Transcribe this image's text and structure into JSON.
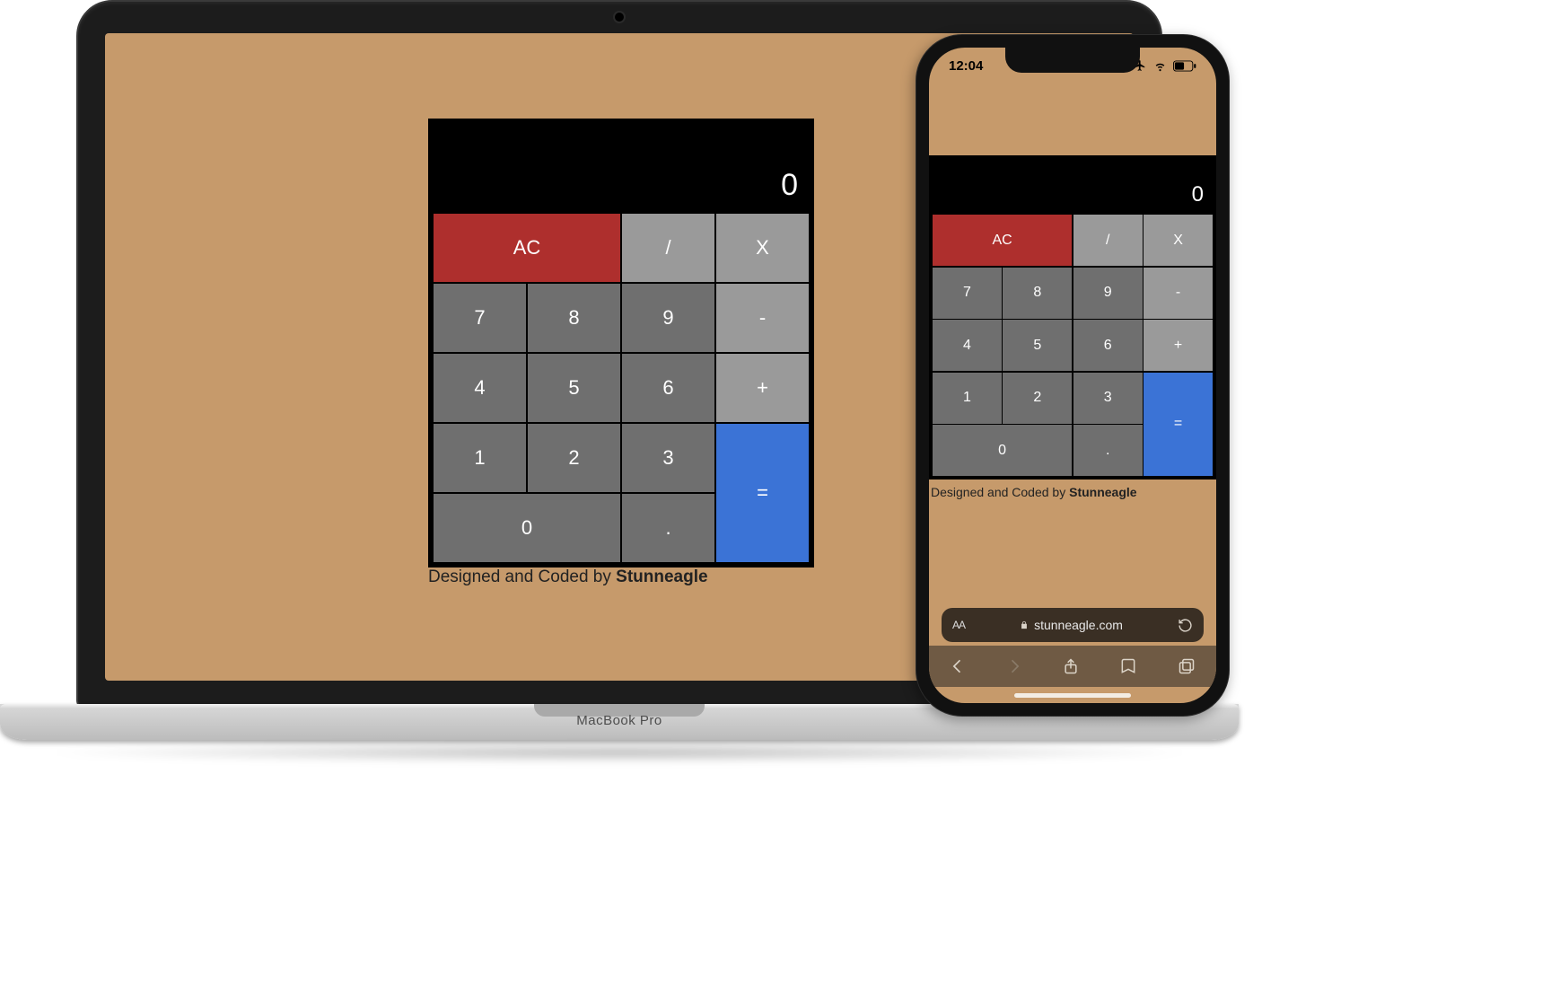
{
  "laptop": {
    "model_label": "MacBook Pro"
  },
  "calculator": {
    "display": "0",
    "buttons": {
      "ac": "AC",
      "divide": "/",
      "multiply": "X",
      "seven": "7",
      "eight": "8",
      "nine": "9",
      "minus": "-",
      "four": "4",
      "five": "5",
      "six": "6",
      "plus": "+",
      "one": "1",
      "two": "2",
      "three": "3",
      "equals": "=",
      "zero": "0",
      "decimal": "."
    }
  },
  "credit": {
    "prefix": "Designed and Coded by ",
    "author": "Stunneagle"
  },
  "phone": {
    "status_time": "12:04",
    "safari_domain": "stunneagle.com"
  }
}
